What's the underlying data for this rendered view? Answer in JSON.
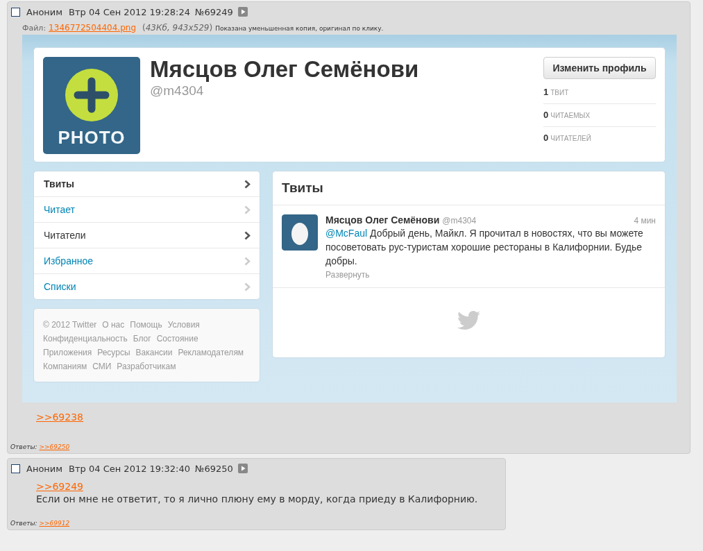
{
  "posts": [
    {
      "checked": false,
      "author": "Аноним",
      "date": "Втр 04 Сен 2012 19:28:24",
      "number": "№69249",
      "file": {
        "label": "Файл:",
        "name": "1346772504404.png",
        "info": "(*43Кб, 943x529*)",
        "note": "Показана уменьшенная копия, оригинал по клику."
      },
      "screenshot": {
        "profile": {
          "avatar_label": "PHOTO",
          "name": "Мясцов Олег Семёнови",
          "handle": "@m4304",
          "button": "Изменить профиль",
          "stats": [
            {
              "count": "1",
              "label": "ТВИТ"
            },
            {
              "count": "0",
              "label": "ЧИТАЕМЫХ"
            },
            {
              "count": "0",
              "label": "ЧИТАТЕЛЕЙ"
            }
          ]
        },
        "nav": [
          {
            "label": "Твиты",
            "selected": true,
            "hovered": false
          },
          {
            "label": "Читает",
            "selected": false,
            "hovered": false
          },
          {
            "label": "Читатели",
            "selected": false,
            "hovered": true
          },
          {
            "label": "Избранное",
            "selected": false,
            "hovered": false
          },
          {
            "label": "Списки",
            "selected": false,
            "hovered": false
          }
        ],
        "footer_links": [
          "© 2012 Twitter",
          "О нас",
          "Помощь",
          "Условия",
          "Конфиденциальность",
          "Блог",
          "Состояние",
          "Приложения",
          "Ресурсы",
          "Вакансии",
          "Рекламодателям",
          "Компаниям",
          "СМИ",
          "Разработчикам"
        ],
        "tweets": {
          "title": "Твиты",
          "tweet": {
            "name": "Мясцов Олег Семёнови",
            "handle": "@m4304",
            "time": "4 мин",
            "mention": "@McFaul",
            "text": "Добрый день, Майкл. Я прочитал в новостях, что вы можете посоветовать рус-туристам хорошие рестораны в Калифорнии. Будье добры.",
            "expand": "Развернуть"
          }
        }
      },
      "links": [
        ">>69238"
      ],
      "replies_label": "Ответы:",
      "replies": [
        ">>69250"
      ]
    },
    {
      "checked": false,
      "author": "Аноним",
      "date": "Втр 04 Сен 2012 19:32:40",
      "number": "№69250",
      "links": [
        ">>69249"
      ],
      "text": "Если он мне не ответит, то я лично плюну ему в морду, когда приеду в Калифорнию.",
      "replies_label": "Ответы:",
      "replies": [
        ">>69912"
      ]
    }
  ]
}
